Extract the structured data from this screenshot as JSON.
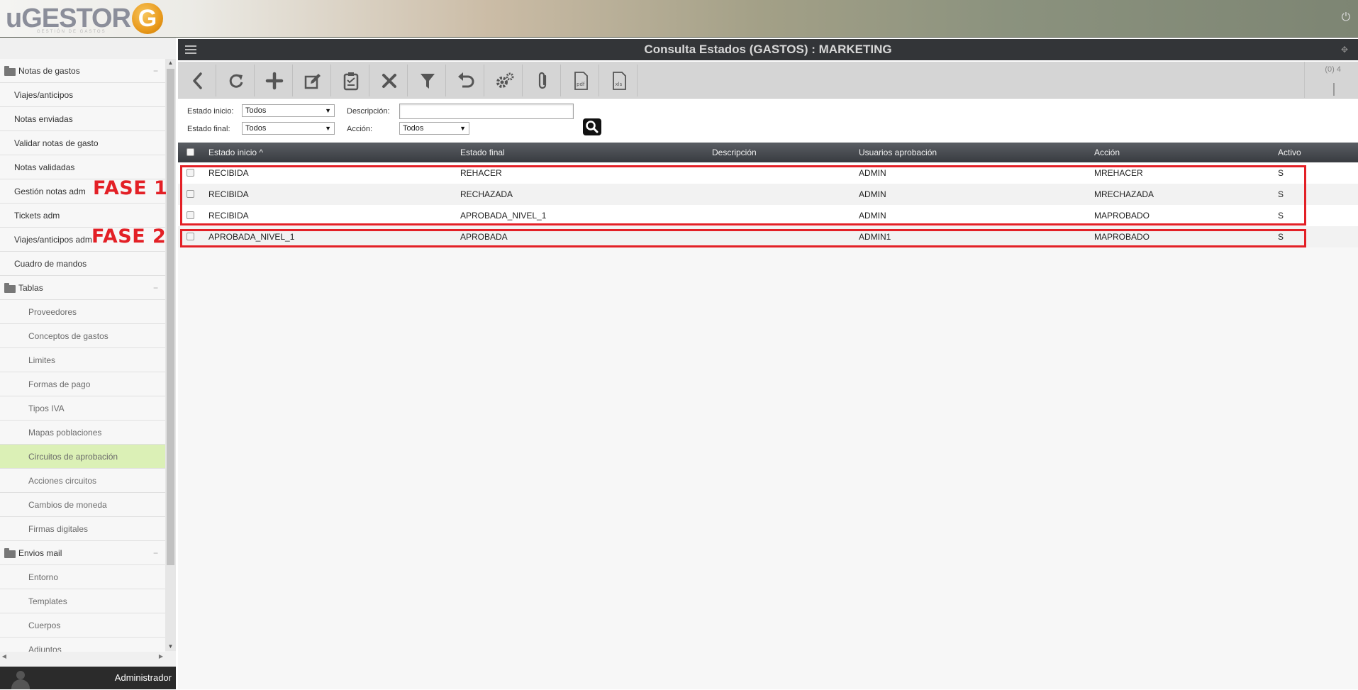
{
  "app": {
    "logo_text": "uGESTOR",
    "logo_mark": "G",
    "logo_subtitle": "GESTIÓN DE GASTOS"
  },
  "header": {
    "title": "Consulta Estados (GASTOS) : MARKETING"
  },
  "sidebar": {
    "items": [
      {
        "label": "Notas de gastos",
        "type": "section"
      },
      {
        "label": "Viajes/anticipos",
        "type": "lvl1"
      },
      {
        "label": "Notas enviadas",
        "type": "lvl1"
      },
      {
        "label": "Validar notas de gasto",
        "type": "lvl1"
      },
      {
        "label": "Notas validadas",
        "type": "lvl1"
      },
      {
        "label": "Gestión notas adm",
        "type": "lvl1"
      },
      {
        "label": "Tickets adm",
        "type": "lvl1"
      },
      {
        "label": "Viajes/anticipos adm",
        "type": "lvl1"
      },
      {
        "label": "Cuadro de mandos",
        "type": "lvl1"
      },
      {
        "label": "Tablas",
        "type": "section"
      },
      {
        "label": "Proveedores",
        "type": "lvl2"
      },
      {
        "label": "Conceptos de gastos",
        "type": "lvl2"
      },
      {
        "label": "Limites",
        "type": "lvl2"
      },
      {
        "label": "Formas de pago",
        "type": "lvl2"
      },
      {
        "label": "Tipos IVA",
        "type": "lvl2"
      },
      {
        "label": "Mapas poblaciones",
        "type": "lvl2"
      },
      {
        "label": "Circuitos de aprobación",
        "type": "lvl2",
        "active": true
      },
      {
        "label": "Acciones circuitos",
        "type": "lvl2"
      },
      {
        "label": "Cambios de moneda",
        "type": "lvl2"
      },
      {
        "label": "Firmas digitales",
        "type": "lvl2"
      },
      {
        "label": "Envios mail",
        "type": "section"
      },
      {
        "label": "Entorno",
        "type": "lvl2"
      },
      {
        "label": "Templates",
        "type": "lvl2"
      },
      {
        "label": "Cuerpos",
        "type": "lvl2"
      },
      {
        "label": "Adjuntos",
        "type": "lvl2"
      }
    ],
    "collapse_symbol": "−",
    "user": "Administrador"
  },
  "annotations": {
    "fase1": "FASE 1",
    "fase2": "FASE 2",
    "color": "#e32026"
  },
  "toolbar": {
    "buttons": [
      "back-icon",
      "refresh-icon",
      "add-icon",
      "edit-icon",
      "clipboard-icon",
      "delete-icon",
      "filter-icon",
      "undo-icon",
      "settings-icon",
      "attach-icon",
      "pdf-icon",
      "xls-icon"
    ],
    "counter": "(0) 4"
  },
  "filters": {
    "estado_inicio_label": "Estado inicio:",
    "estado_inicio_value": "Todos",
    "estado_final_label": "Estado final:",
    "estado_final_value": "Todos",
    "descripcion_label": "Descripción:",
    "descripcion_value": "",
    "accion_label": "Acción:",
    "accion_value": "Todos"
  },
  "grid": {
    "columns": [
      "Estado inicio ^",
      "Estado final",
      "Descripción",
      "Usuarios aprobación",
      "Acción",
      "Activo"
    ],
    "rows": [
      [
        "RECIBIDA",
        "REHACER",
        "",
        "ADMIN",
        "MREHACER",
        "S"
      ],
      [
        "RECIBIDA",
        "RECHAZADA",
        "",
        "ADMIN",
        "MRECHAZADA",
        "S"
      ],
      [
        "RECIBIDA",
        "APROBADA_NIVEL_1",
        "",
        "ADMIN",
        "MAPROBADO",
        "S"
      ],
      [
        "APROBADA_NIVEL_1",
        "APROBADA",
        "",
        "ADMIN1",
        "MAPROBADO",
        "S"
      ]
    ]
  }
}
